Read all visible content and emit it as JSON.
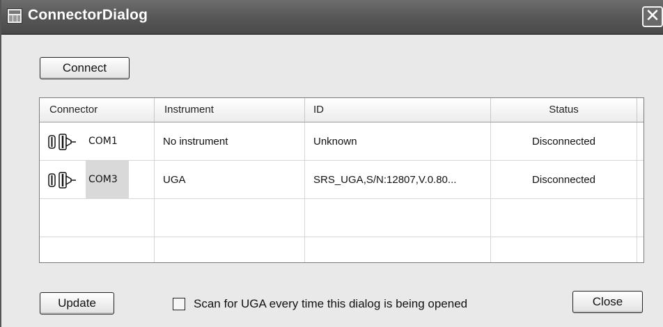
{
  "window": {
    "title": "ConnectorDialog",
    "close_glyph": "✕"
  },
  "toolbar": {
    "connect_label": "Connect"
  },
  "grid": {
    "headers": [
      "Connector",
      "Instrument",
      "ID",
      "Status"
    ],
    "rows": [
      {
        "connector": "COM1",
        "instrument": "No instrument",
        "id": "Unknown",
        "status": "Disconnected"
      },
      {
        "connector": "COM3",
        "instrument": "UGA",
        "id": "SRS_UGA,S/N:12807,V.0.80...",
        "status": "Disconnected"
      }
    ]
  },
  "footer": {
    "update_label": "Update",
    "scan_checkbox_label": "Scan for UGA every time this dialog is being opened",
    "scan_checked": false,
    "close_label": "Close"
  },
  "icons": {
    "window_icon": "window-app-icon",
    "connector_icon": "serial-connector-icon",
    "close_icon": "close-icon"
  }
}
